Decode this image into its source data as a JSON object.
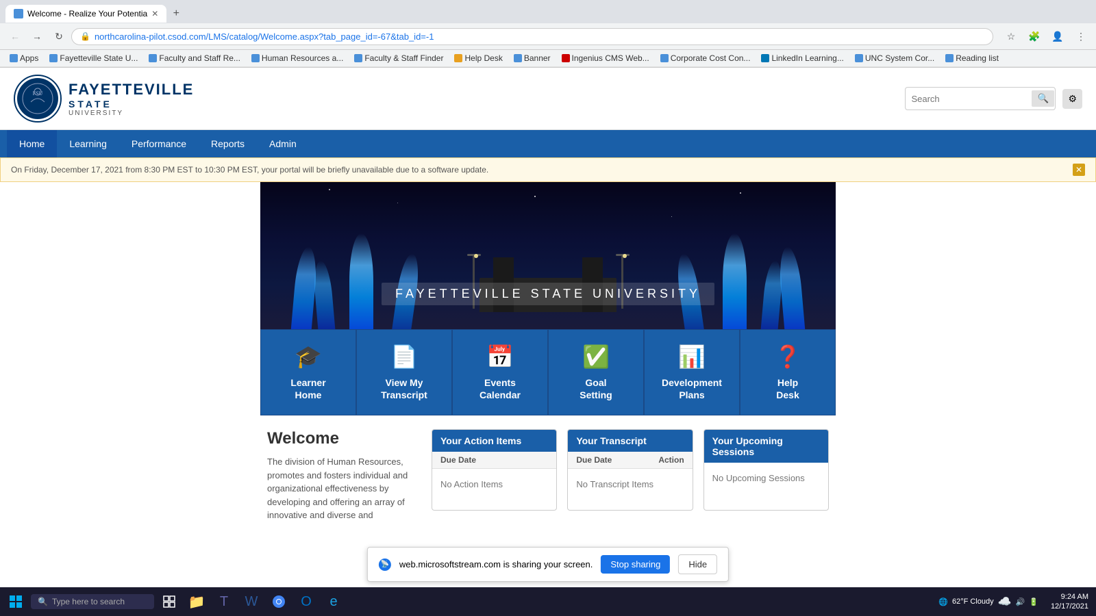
{
  "browser": {
    "tab": {
      "title": "Welcome - Realize Your Potentia",
      "url": "northcarolina-pilot.csod.com/LMS/catalog/Welcome.aspx?tab_page_id=-67&tab_id=-1"
    },
    "bookmarks": [
      {
        "label": "Apps",
        "color": "#4a90d9"
      },
      {
        "label": "Fayetteville State U...",
        "color": "#4a90d9"
      },
      {
        "label": "Faculty and Staff Re...",
        "color": "#4a90d9"
      },
      {
        "label": "Human Resources a...",
        "color": "#4a90d9"
      },
      {
        "label": "Faculty & Staff Finder",
        "color": "#4a90d9"
      },
      {
        "label": "Help Desk",
        "color": "#e8a020"
      },
      {
        "label": "Banner",
        "color": "#4a90d9"
      },
      {
        "label": "Ingenius CMS Web...",
        "color": "#cc0000"
      },
      {
        "label": "Corporate Cost Con...",
        "color": "#4a90d9"
      },
      {
        "label": "LinkedIn Learning...",
        "color": "#0077b5"
      },
      {
        "label": "UNC System Cor...",
        "color": "#4a90d9"
      },
      {
        "label": "Reading list",
        "color": "#4a90d9"
      }
    ]
  },
  "header": {
    "logo": {
      "university": "FAYETTEVILLE",
      "state": "STATE",
      "subtitle": "UNIVERSITY"
    },
    "search": {
      "placeholder": "Search",
      "button_label": "🔍"
    },
    "settings_label": "⚙"
  },
  "nav": {
    "items": [
      {
        "label": "Home",
        "active": true
      },
      {
        "label": "Learning"
      },
      {
        "label": "Performance"
      },
      {
        "label": "Reports"
      },
      {
        "label": "Admin"
      }
    ]
  },
  "alert": {
    "message": "On Friday, December 17, 2021 from 8:30 PM EST to 10:30 PM EST, your portal will be briefly unavailable due to a software update."
  },
  "hero": {
    "title": "FAYETTEVILLE STATE  UNIVERSITY"
  },
  "quick_links": [
    {
      "id": "learner-home",
      "icon": "🎓",
      "label": "Learner\nHome"
    },
    {
      "id": "view-transcript",
      "icon": "📄",
      "label": "View My\nTranscript"
    },
    {
      "id": "events-calendar",
      "icon": "📅",
      "label": "Events\nCalendar"
    },
    {
      "id": "goal-setting",
      "icon": "✅",
      "label": "Goal\nSetting"
    },
    {
      "id": "development-plans",
      "icon": "📊",
      "label": "Development\nPlans"
    },
    {
      "id": "help-desk",
      "icon": "❓",
      "label": "Help\nDesk"
    }
  ],
  "welcome": {
    "title": "Welcome",
    "text": "The division of Human Resources, promotes and fosters individual and organizational effectiveness by developing and offering an array of innovative and diverse and"
  },
  "panels": {
    "action_items": {
      "title": "Your Action Items",
      "col1": "Due Date",
      "empty_message": "No Action Items"
    },
    "transcript": {
      "title": "Your Transcript",
      "col1": "Due Date",
      "col2": "Action",
      "empty_message": "No Transcript Items"
    },
    "upcoming_sessions": {
      "title": "Your Upcoming Sessions",
      "empty_message": "No Upcoming Sessions"
    }
  },
  "screen_share": {
    "message": "web.microsoftstream.com is sharing your screen.",
    "stop_label": "Stop sharing",
    "hide_label": "Hide"
  },
  "taskbar": {
    "search_placeholder": "Type here to search",
    "weather": "62°F Cloudy",
    "time": "9:24 AM",
    "date": "12/17/2021"
  }
}
